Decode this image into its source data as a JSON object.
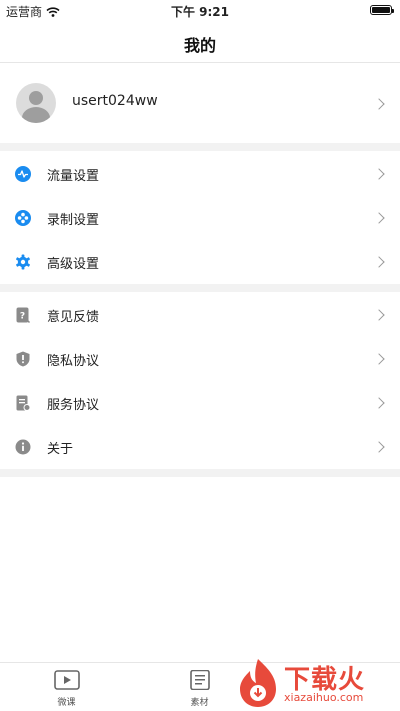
{
  "status_bar": {
    "carrier": "运营商",
    "time": "下午 9:21"
  },
  "nav": {
    "title": "我的"
  },
  "profile": {
    "username": "usert024ww"
  },
  "menu_group_1": [
    {
      "label": "流量设置",
      "icon": "traffic-icon"
    },
    {
      "label": "录制设置",
      "icon": "record-icon"
    },
    {
      "label": "高级设置",
      "icon": "gear-icon"
    }
  ],
  "menu_group_2": [
    {
      "label": "意见反馈",
      "icon": "feedback-icon"
    },
    {
      "label": "隐私协议",
      "icon": "privacy-shield-icon"
    },
    {
      "label": "服务协议",
      "icon": "service-doc-icon"
    },
    {
      "label": "关于",
      "icon": "info-icon"
    }
  ],
  "tab_bar": [
    {
      "label": "微课",
      "icon": "video-icon"
    },
    {
      "label": "素材",
      "icon": "material-icon"
    }
  ],
  "watermark": {
    "text": "下载火",
    "url": "xiazaihuo.com"
  },
  "colors": {
    "accent": "#1a8cf0",
    "gray_icon": "#8a8a8a",
    "watermark": "#e74a3b"
  }
}
